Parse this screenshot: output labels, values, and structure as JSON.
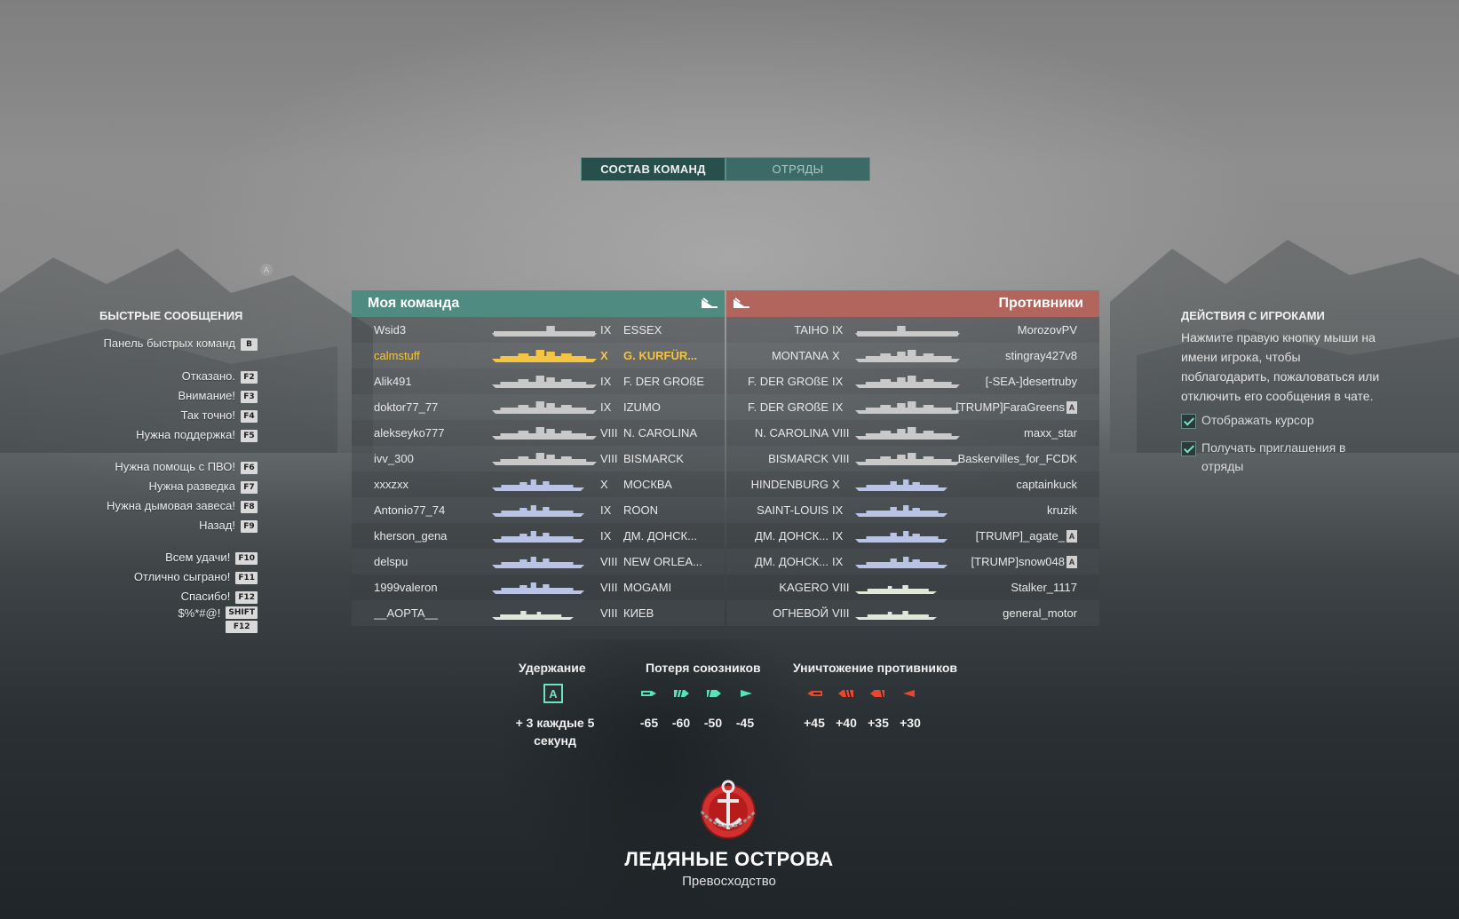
{
  "tabs": [
    "СОСТАВ КОМАНД",
    "ОТРЯДЫ"
  ],
  "quick_messages": {
    "title": "БЫСТРЫЕ СООБЩЕНИЯ",
    "items": [
      {
        "label": "Панель быстрых команд",
        "keys": [
          "B"
        ]
      },
      {
        "label": "Отказано.",
        "keys": [
          "F2"
        ]
      },
      {
        "label": "Внимание!",
        "keys": [
          "F3"
        ]
      },
      {
        "label": "Так точно!",
        "keys": [
          "F4"
        ]
      },
      {
        "label": "Нужна поддержка!",
        "keys": [
          "F5"
        ]
      },
      {
        "label": "Нужна помощь с ПВО!",
        "keys": [
          "F6"
        ]
      },
      {
        "label": "Нужна разведка",
        "keys": [
          "F7"
        ]
      },
      {
        "label": "Нужна дымовая завеса!",
        "keys": [
          "F8"
        ]
      },
      {
        "label": "Назад!",
        "keys": [
          "F9"
        ]
      },
      {
        "label": "Всем удачи!",
        "keys": [
          "F10"
        ]
      },
      {
        "label": "Отлично сыграно!",
        "keys": [
          "F11"
        ]
      },
      {
        "label": "Спасибо!",
        "keys": [
          "F12"
        ]
      },
      {
        "label": "$%*#@!",
        "keys": [
          "SHIFT",
          "F12"
        ]
      }
    ]
  },
  "player_actions": {
    "title": "ДЕЙСТВИЯ С ИГРОКАМИ",
    "description": "Нажмите правую кнопку мыши на имени игрока, чтобы поблагодарить, пожаловаться или отключить его сообщения в чате.",
    "checkboxes": [
      {
        "label": "Отображать курсор",
        "checked": true
      },
      {
        "label": "Получать приглашения в отряды",
        "checked": true
      }
    ]
  },
  "my_team": {
    "title": "Моя команда",
    "color": "#4f8b80",
    "rows": [
      {
        "player": "Wsid3",
        "tier": "IX",
        "ship": "ESSEX",
        "class": "cv",
        "self": false
      },
      {
        "player": "calmstuff",
        "tier": "X",
        "ship": "G. KURFÜR...",
        "class": "bb",
        "self": true
      },
      {
        "player": "Alik491",
        "tier": "IX",
        "ship": "F. DER GROßE",
        "class": "bb",
        "self": false
      },
      {
        "player": "doktor77_77",
        "tier": "IX",
        "ship": "IZUMO",
        "class": "bb",
        "self": false
      },
      {
        "player": "alekseyko777",
        "tier": "VIII",
        "ship": "N. CAROLINA",
        "class": "bb",
        "self": false
      },
      {
        "player": "ivv_300",
        "tier": "VIII",
        "ship": "BISMARCK",
        "class": "bb",
        "self": false
      },
      {
        "player": "xxxzxx",
        "tier": "X",
        "ship": "МОСКВА",
        "class": "ca",
        "self": false
      },
      {
        "player": "Antonio77_74",
        "tier": "IX",
        "ship": "ROON",
        "class": "ca",
        "self": false
      },
      {
        "player": "kherson_gena",
        "tier": "IX",
        "ship": "ДМ. ДОНСК...",
        "class": "ca",
        "self": false
      },
      {
        "player": "delspu",
        "tier": "VIII",
        "ship": "NEW ORLEA...",
        "class": "ca",
        "self": false
      },
      {
        "player": "1999valeron",
        "tier": "VIII",
        "ship": "MOGAMI",
        "class": "ca",
        "self": false
      },
      {
        "player": "__AOPTA__",
        "tier": "VIII",
        "ship": "КИЕВ",
        "class": "dd",
        "self": false
      }
    ]
  },
  "enemy_team": {
    "title": "Противники",
    "color": "#b2655c",
    "rows": [
      {
        "player": "MorozovPV",
        "tier": "IX",
        "ship": "TAIHO",
        "class": "cv",
        "division": false
      },
      {
        "player": "stingray427v8",
        "tier": "X",
        "ship": "MONTANA",
        "class": "bb",
        "division": false
      },
      {
        "player": "[-SEA-]desertruby",
        "tier": "IX",
        "ship": "F. DER GROßE",
        "class": "bb",
        "division": false
      },
      {
        "player": "[TRUMP]FaraGreens",
        "tier": "IX",
        "ship": "F. DER GROßE",
        "class": "bb",
        "division": true
      },
      {
        "player": "maxx_star",
        "tier": "VIII",
        "ship": "N. CAROLINA",
        "class": "bb",
        "division": false
      },
      {
        "player": "Baskervilles_for_FCDK",
        "tier": "VIII",
        "ship": "BISMARCK",
        "class": "bb",
        "division": false
      },
      {
        "player": "captainkuck",
        "tier": "X",
        "ship": "HINDENBURG",
        "class": "ca",
        "division": false
      },
      {
        "player": "kruzik",
        "tier": "IX",
        "ship": "SAINT-LOUIS",
        "class": "ca",
        "division": false
      },
      {
        "player": "[TRUMP]_agate_",
        "tier": "IX",
        "ship": "ДМ. ДОНСК...",
        "class": "ca",
        "division": true
      },
      {
        "player": "[TRUMP]snow048",
        "tier": "IX",
        "ship": "ДМ. ДОНСК...",
        "class": "ca",
        "division": true
      },
      {
        "player": "Stalker_1117",
        "tier": "VIII",
        "ship": "KAGERO",
        "class": "dd",
        "division": false
      },
      {
        "player": "general_motor",
        "tier": "VIII",
        "ship": "ОГНЕВОЙ",
        "class": "dd",
        "division": false
      }
    ]
  },
  "division_badge": "A",
  "scoring": {
    "capture": {
      "title": "Удержание",
      "point": "A",
      "text": "+ 3 каждые 5 секунд"
    },
    "ally_loss": {
      "title": "Потеря союзников",
      "values": [
        "-65",
        "-60",
        "-50",
        "-45"
      ],
      "color": "#58e3b6"
    },
    "enemy_kill": {
      "title": "Уничтожение противников",
      "values": [
        "+45",
        "+40",
        "+35",
        "+30"
      ],
      "color": "#e8462e"
    }
  },
  "map": {
    "name": "ЛЕДЯНЫЕ ОСТРОВА",
    "mode": "Превосходство"
  },
  "colors": {
    "self_player": "#f5c542",
    "ship_silhouette": "#c9c9c9",
    "ship_silhouette_cruiser": "#b9c3e6",
    "ship_silhouette_dd": "#dfe6da"
  }
}
